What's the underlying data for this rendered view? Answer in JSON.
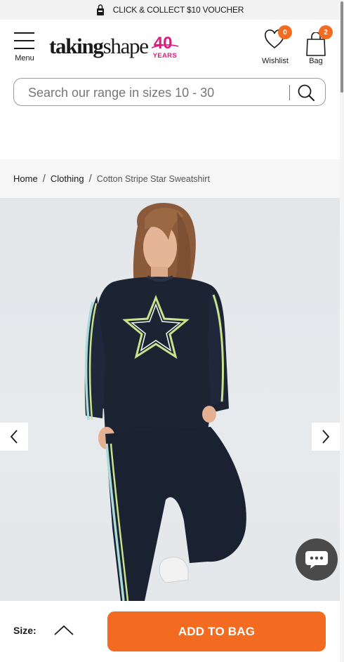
{
  "promo": {
    "text": "CLICK & COLLECT $10 VOUCHER",
    "icon": "shopping-bag-icon"
  },
  "header": {
    "menu_label": "Menu",
    "logo": {
      "word1": "taking",
      "word2": "shape",
      "anniversary_number": "40",
      "anniversary_word": "YEARS"
    },
    "wishlist": {
      "label": "Wishlist",
      "count": "0",
      "icon": "heart-icon"
    },
    "bag": {
      "label": "Bag",
      "count": "2",
      "icon": "bag-icon"
    }
  },
  "search": {
    "placeholder": "Search our range in sizes 10 - 30",
    "icon": "search-icon"
  },
  "breadcrumb": {
    "items": [
      "Home",
      "Clothing"
    ],
    "current": "Cotton Stripe Star Sweatshirt",
    "separator": "/"
  },
  "gallery": {
    "prev_icon": "chevron-left-icon",
    "next_icon": "chevron-right-icon",
    "chat_icon": "chat-bubble-icon"
  },
  "product_bar": {
    "size_label": "Size:",
    "size_toggle_icon": "chevron-up-icon",
    "add_to_bag_label": "ADD TO BAG"
  },
  "colors": {
    "accent": "#f26b21",
    "brand_pink": "#e3187e",
    "garment_navy": "#1c2434",
    "stripe_mint": "#a8dcd9",
    "stripe_lime": "#c8e38a"
  }
}
